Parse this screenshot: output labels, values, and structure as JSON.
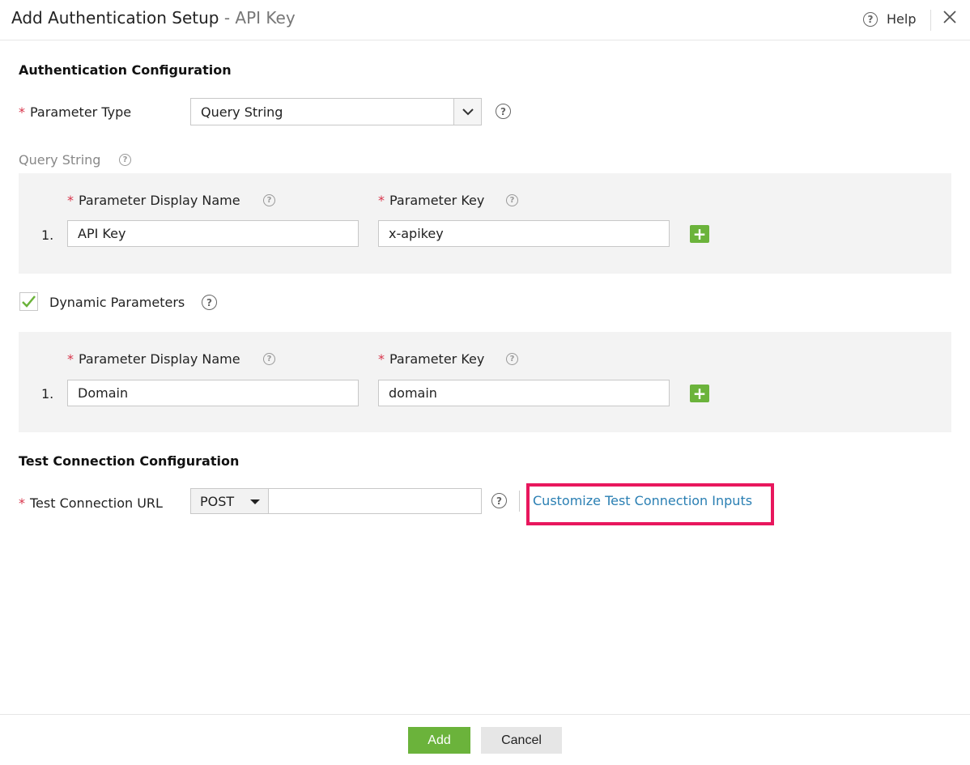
{
  "header": {
    "title": "Add Authentication Setup",
    "separator": " - ",
    "subtitle": "API Key",
    "help_label": "Help",
    "help_icon": "question-circle-icon",
    "close_icon": "close-icon"
  },
  "auth_config": {
    "section_title": "Authentication Configuration",
    "parameter_type_label": "Parameter Type",
    "parameter_type_value": "Query String",
    "query_string_label": "Query String",
    "query_params": {
      "display_name_header": "Parameter Display Name",
      "key_header": "Parameter Key",
      "rows": [
        {
          "num": "1.",
          "display_name": "API Key",
          "key": "x-apikey"
        }
      ]
    },
    "dynamic_parameters_label": "Dynamic Parameters",
    "dynamic_parameters_checked": true,
    "dynamic_params": {
      "display_name_header": "Parameter Display Name",
      "key_header": "Parameter Key",
      "rows": [
        {
          "num": "1.",
          "display_name": "Domain",
          "key": "domain"
        }
      ]
    }
  },
  "test_connection": {
    "section_title": "Test Connection Configuration",
    "url_label": "Test Connection URL",
    "method": "POST",
    "url_value": "",
    "customize_link": "Customize Test Connection Inputs"
  },
  "footer": {
    "add_label": "Add",
    "cancel_label": "Cancel"
  },
  "colors": {
    "accent_green": "#6bb33b",
    "required_red": "#d8344a",
    "link_blue": "#2a7fb3",
    "highlight_pink": "#e8175d"
  }
}
